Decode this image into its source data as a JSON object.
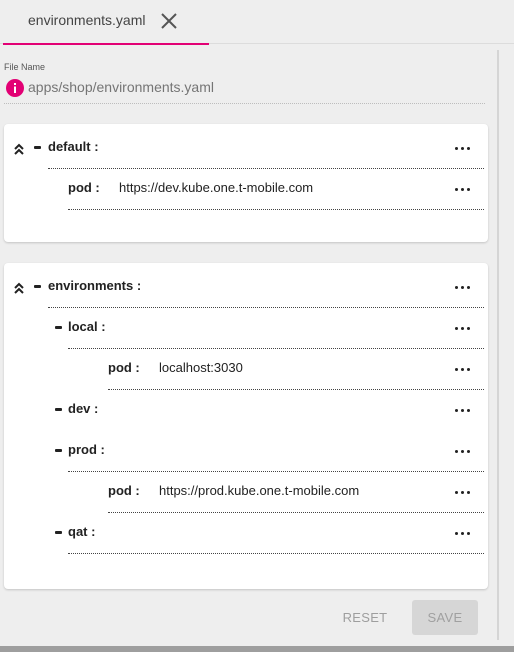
{
  "tab": {
    "label": "environments.yaml"
  },
  "file": {
    "label": "File Name",
    "path": "apps/shop/environments.yaml"
  },
  "default_section": {
    "key": "default :",
    "children": [
      {
        "key": "pod :",
        "value": "https://dev.kube.one.t-mobile.com"
      }
    ]
  },
  "environments_section": {
    "key": "environments :",
    "children": [
      {
        "key": "local :",
        "pod_key": "pod :",
        "pod_value": "localhost:3030"
      },
      {
        "key": "dev :"
      },
      {
        "key": "prod :",
        "pod_key": "pod :",
        "pod_value": "https://prod.kube.one.t-mobile.com"
      },
      {
        "key": "qat :"
      }
    ]
  },
  "actions": {
    "reset_label": "RESET",
    "save_label": "SAVE"
  },
  "colors": {
    "accent": "#e20074",
    "background": "#eeeeee",
    "card": "#ffffff"
  },
  "icons": {
    "close": "close-icon",
    "info": "info-icon",
    "collapse": "double-chevron-up-icon",
    "more": "more-horizontal-icon"
  }
}
